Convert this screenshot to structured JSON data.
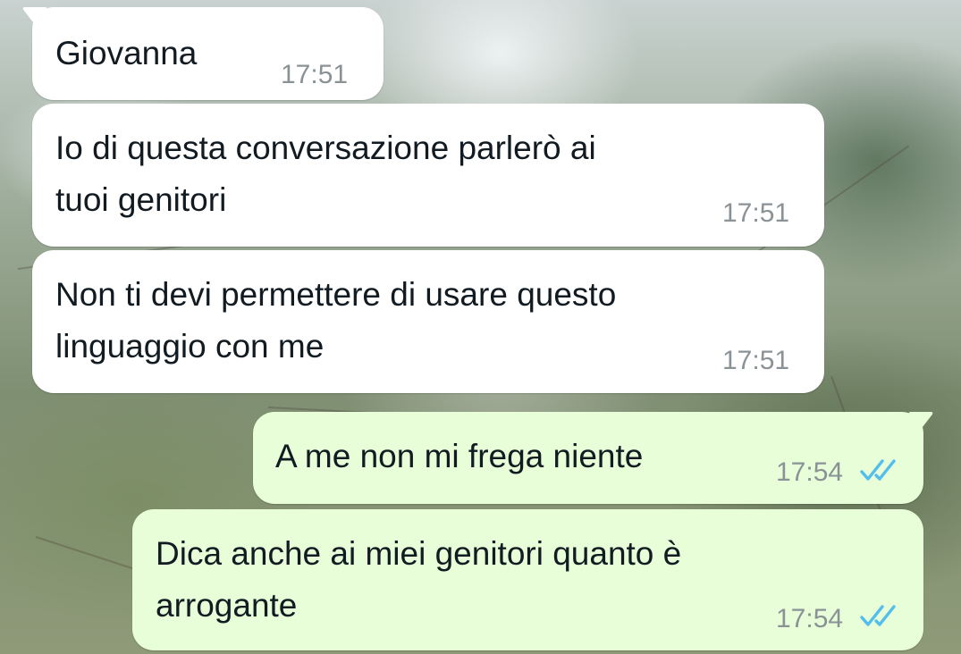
{
  "contact": {
    "name": "Giovanna",
    "time": "17:51"
  },
  "messages": [
    {
      "id": "m1",
      "direction": "incoming",
      "lines": [
        "Io di questa conversazione parlerò ai",
        "tuoi genitori"
      ],
      "time": "17:51"
    },
    {
      "id": "m2",
      "direction": "incoming",
      "lines": [
        "Non ti devi permettere di usare questo",
        "linguaggio con me"
      ],
      "time": "17:51"
    },
    {
      "id": "m3",
      "direction": "outgoing",
      "lines": [
        "A me non mi frega niente"
      ],
      "time": "17:54",
      "status_icon": "double-check-read-icon"
    },
    {
      "id": "m4",
      "direction": "outgoing",
      "lines": [
        "Dica anche ai miei genitori quanto è",
        "arrogante"
      ],
      "time": "17:54",
      "status_icon": "double-check-read-icon"
    }
  ],
  "colors": {
    "incoming_bubble": "#ffffff",
    "outgoing_bubble": "#e7fed8",
    "text": "#111b21",
    "timestamp": "#8a9296",
    "read_ticks": "#53bdeb"
  }
}
